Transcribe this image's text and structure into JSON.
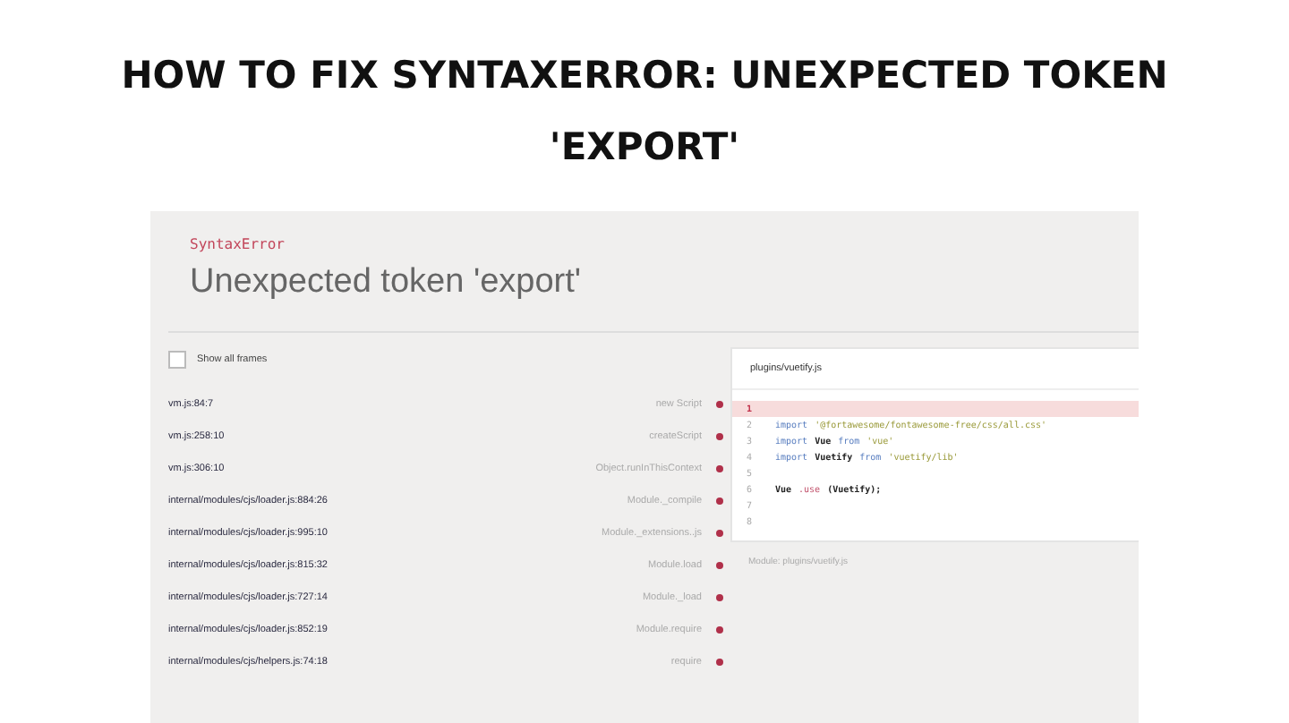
{
  "title": "HOW TO FIX SYNTAXERROR: UNEXPECTED TOKEN 'EXPORT'",
  "error": {
    "type": "SyntaxError",
    "message": "Unexpected token 'export'"
  },
  "show_all_frames": {
    "label": "Show all frames",
    "checked": false
  },
  "frames": [
    {
      "location": "vm.js:84:7",
      "function": "new Script"
    },
    {
      "location": "vm.js:258:10",
      "function": "createScript"
    },
    {
      "location": "vm.js:306:10",
      "function": "Object.runInThisContext"
    },
    {
      "location": "internal/modules/cjs/loader.js:884:26",
      "function": "Module._compile"
    },
    {
      "location": "internal/modules/cjs/loader.js:995:10",
      "function": "Module._extensions..js"
    },
    {
      "location": "internal/modules/cjs/loader.js:815:32",
      "function": "Module.load"
    },
    {
      "location": "internal/modules/cjs/loader.js:727:14",
      "function": "Module._load"
    },
    {
      "location": "internal/modules/cjs/loader.js:852:19",
      "function": "Module.require"
    },
    {
      "location": "internal/modules/cjs/helpers.js:74:18",
      "function": "require"
    }
  ],
  "code_panel": {
    "file": "plugins/vuetify.js",
    "footer": "Module: plugins/vuetify.js",
    "lines": [
      {
        "number": "1",
        "highlighted": true
      },
      {
        "number": "2",
        "highlighted": false,
        "tokens": [
          {
            "kind": "keyword",
            "text": "import"
          },
          {
            "kind": "string",
            "text": "'@fortawesome/fontawesome-free/css/all.css'"
          }
        ]
      },
      {
        "number": "3",
        "highlighted": false,
        "tokens": [
          {
            "kind": "keyword",
            "text": "import"
          },
          {
            "kind": "plain",
            "text": "Vue"
          },
          {
            "kind": "keyword",
            "text": "from"
          },
          {
            "kind": "string",
            "text": "'vue'"
          }
        ]
      },
      {
        "number": "4",
        "highlighted": false,
        "tokens": [
          {
            "kind": "keyword",
            "text": "import"
          },
          {
            "kind": "plain",
            "text": "Vuetify"
          },
          {
            "kind": "keyword",
            "text": "from"
          },
          {
            "kind": "string",
            "text": "'vuetify/lib'"
          }
        ]
      },
      {
        "number": "5",
        "highlighted": false
      },
      {
        "number": "6",
        "highlighted": false,
        "tokens": [
          {
            "kind": "plain",
            "text": "Vue"
          },
          {
            "kind": "method",
            "text": ".use"
          },
          {
            "kind": "plain",
            "text": "(Vuetify);"
          }
        ]
      },
      {
        "number": "7",
        "highlighted": false
      },
      {
        "number": "8",
        "highlighted": false
      }
    ]
  }
}
